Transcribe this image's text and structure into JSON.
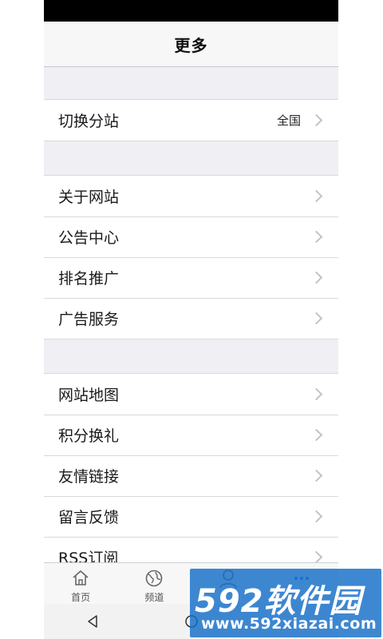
{
  "header": {
    "title": "更多"
  },
  "groups": [
    {
      "items": [
        {
          "label": "切换分站",
          "value": "全国"
        }
      ]
    },
    {
      "items": [
        {
          "label": "关于网站"
        },
        {
          "label": "公告中心"
        },
        {
          "label": "排名推广"
        },
        {
          "label": "广告服务"
        }
      ]
    },
    {
      "items": [
        {
          "label": "网站地图"
        },
        {
          "label": "积分换礼"
        },
        {
          "label": "友情链接"
        },
        {
          "label": "留言反馈"
        },
        {
          "label": "RSS订阅"
        }
      ]
    }
  ],
  "tab_bar": {
    "tabs": [
      {
        "label": "首页",
        "icon": "home-icon"
      },
      {
        "label": "频道",
        "icon": "globe-icon"
      },
      {
        "label": "",
        "icon": "user-icon"
      },
      {
        "label": "",
        "icon": "more-icon"
      }
    ]
  },
  "system_nav": {
    "icons": [
      "back-icon",
      "home-circle-icon"
    ]
  },
  "watermark": {
    "brand": "592软件园",
    "url": "www.592xiazai.com"
  },
  "colors": {
    "background": "#efeff4",
    "status_bar": "#000000",
    "nav_bar": "#f7f7f7",
    "watermark": "#146ec8"
  }
}
